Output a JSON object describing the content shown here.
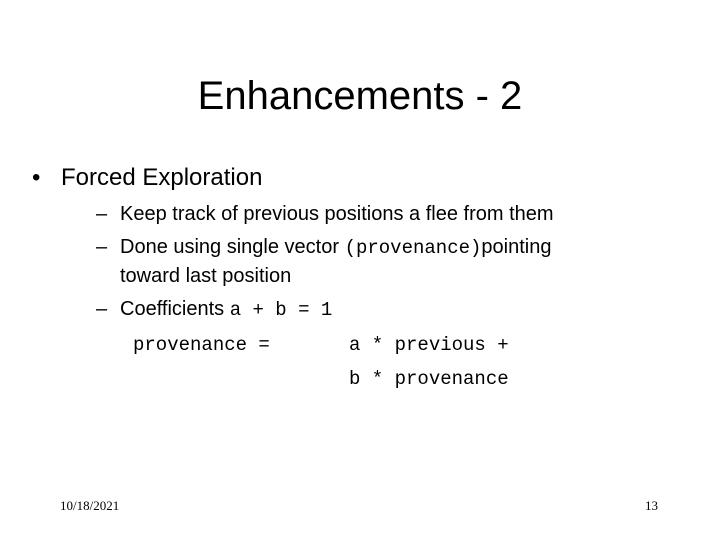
{
  "slide": {
    "title": "Enhancements - 2",
    "bullets": [
      {
        "marker": "•",
        "text": "Forced Exploration",
        "sub": [
          {
            "marker": "–",
            "text": "Keep track of previous positions a flee from them"
          },
          {
            "marker": "–",
            "text_before": "Done using single vector ",
            "code": "(provenance)",
            "text_after": "pointing",
            "continuation": "toward last position"
          },
          {
            "marker": "–",
            "text_before": "Coefficients ",
            "code": "a + b = 1"
          }
        ]
      }
    ],
    "formula": {
      "lhs": "provenance =",
      "line1": "a * previous +",
      "line2": "b * provenance"
    },
    "footer": {
      "date": "10/18/2021",
      "page_number": "13"
    }
  }
}
